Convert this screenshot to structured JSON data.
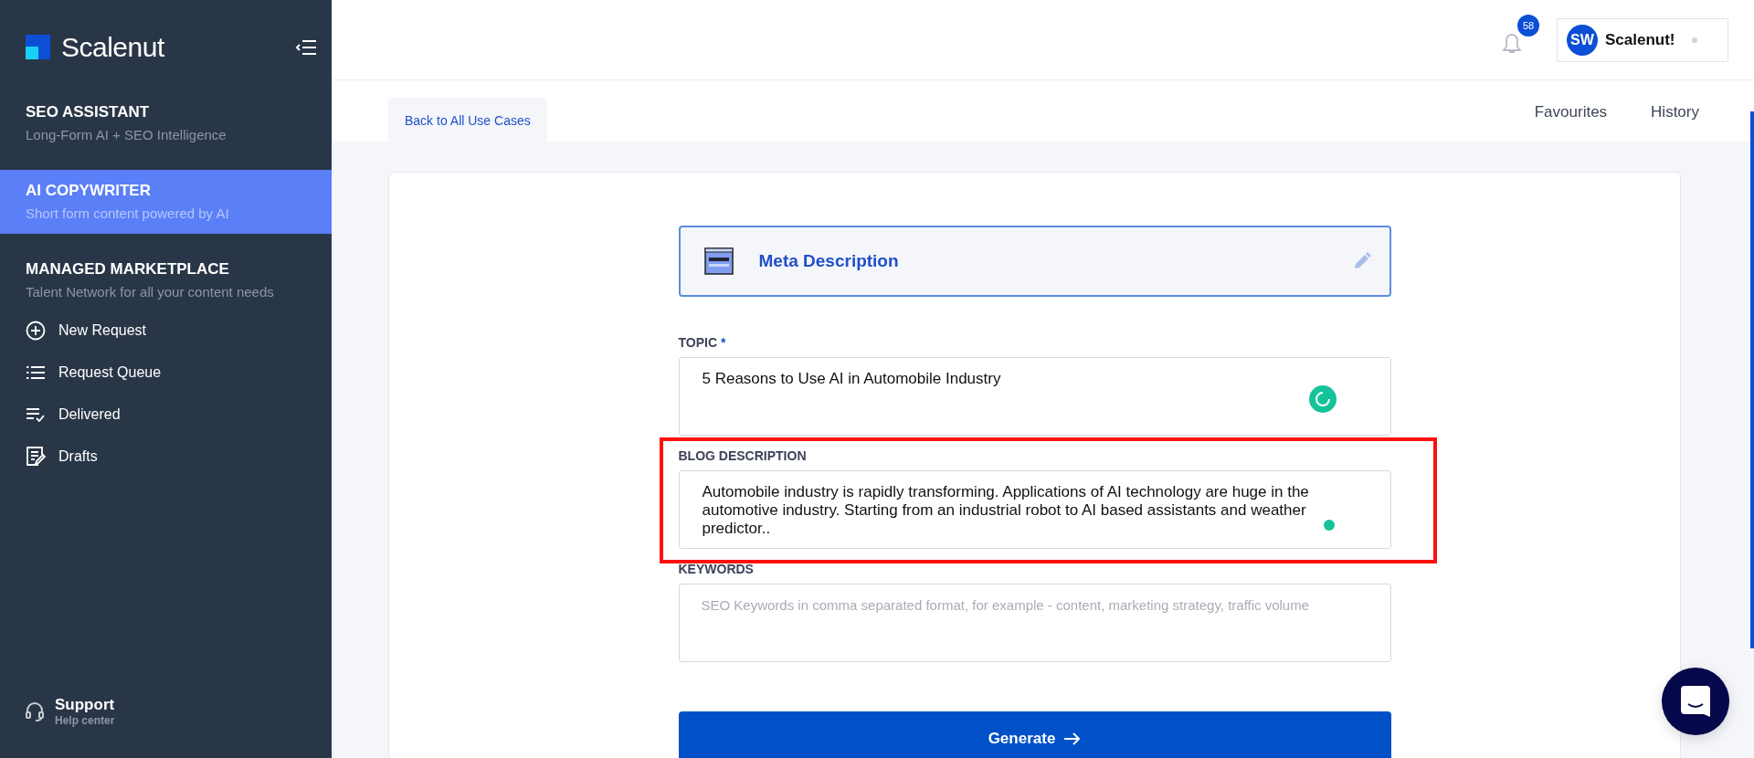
{
  "sidebar": {
    "logo": "Scalenut",
    "sections": [
      {
        "title": "SEO ASSISTANT",
        "subtitle": "Long-Form AI + SEO Intelligence",
        "selected": false
      },
      {
        "title": "AI COPYWRITER",
        "subtitle": "Short form content powered by AI",
        "selected": true
      },
      {
        "title": "MANAGED MARKETPLACE",
        "subtitle": "Talent Network for all your content needs",
        "selected": false
      }
    ],
    "items": [
      "New Request",
      "Request Queue",
      "Delivered",
      "Drafts"
    ],
    "support": {
      "title": "Support",
      "subtitle": "Help center"
    }
  },
  "header": {
    "notification_count": "58",
    "user": {
      "initials": "SW",
      "name": "Scalenut!"
    }
  },
  "nav": {
    "back": "Back to All Use Cases",
    "links": [
      "Favourites",
      "History"
    ]
  },
  "use_case": {
    "title": "Meta Description"
  },
  "form": {
    "fields": [
      {
        "label": "TOPIC",
        "required_mark": "*",
        "value": "5 Reasons to Use AI in Automobile Industry"
      },
      {
        "label": "BLOG DESCRIPTION",
        "value": "Automobile industry is rapidly transforming. Applications of AI technology are huge in the automotive industry. Starting from an industrial robot to AI based assistants and weather predictor.."
      },
      {
        "label": "KEYWORDS",
        "placeholder": "SEO Keywords in comma separated format, for example - content, marketing strategy, traffic volume"
      }
    ],
    "submit": "Generate"
  }
}
